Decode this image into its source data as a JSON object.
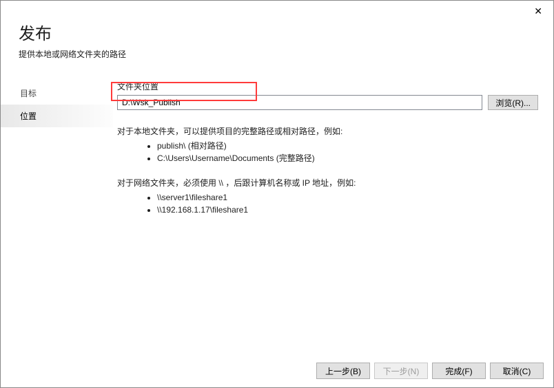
{
  "header": {
    "title": "发布",
    "subtitle": "提供本地或网络文件夹的路径"
  },
  "nav": {
    "items": [
      {
        "label": "目标",
        "active": false
      },
      {
        "label": "位置",
        "active": true
      }
    ]
  },
  "content": {
    "folder_label": "文件夹位置",
    "folder_value": "D:\\Wsk_Publish",
    "browse_label": "浏览(R)...",
    "help_local_title": "对于本地文件夹，可以提供项目的完整路径或相对路径，例如:",
    "help_local_items": [
      "publish\\ (相对路径)",
      "C:\\Users\\Username\\Documents (完整路径)"
    ],
    "help_network_title": "对于网络文件夹，必须使用 \\\\ ，后跟计算机名称或 IP 地址，例如:",
    "help_network_items": [
      "\\\\server1\\fileshare1",
      "\\\\192.168.1.17\\fileshare1"
    ]
  },
  "footer": {
    "back": "上一步(B)",
    "next": "下一步(N)",
    "finish": "完成(F)",
    "cancel": "取消(C)"
  }
}
